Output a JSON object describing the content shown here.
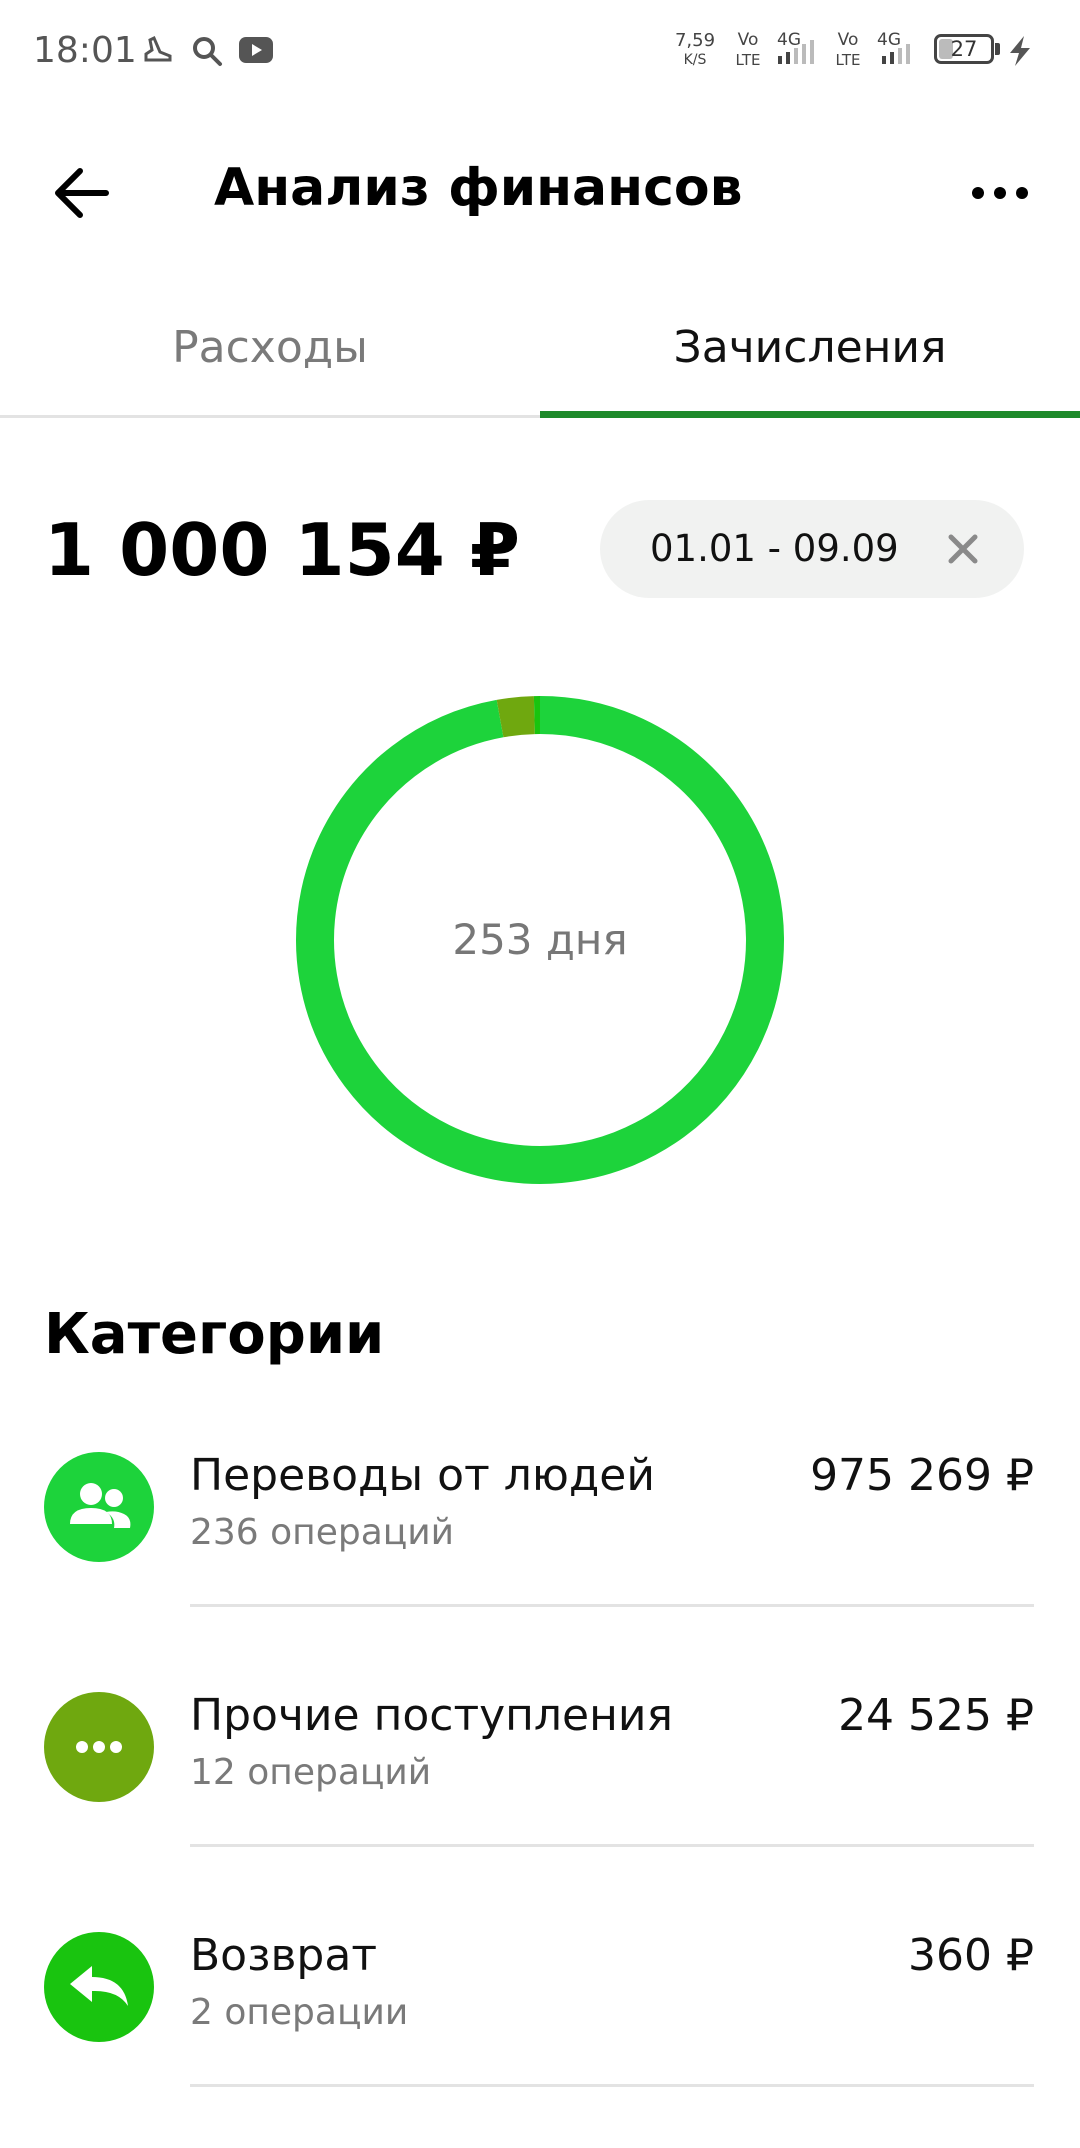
{
  "status_bar": {
    "time": "18:01",
    "net_speed_value": "7,59",
    "net_speed_unit": "K/S",
    "volte1_top": "Vo",
    "volte1_bottom": "LTE",
    "net1": "4G",
    "volte2_top": "Vo",
    "volte2_bottom": "LTE",
    "net2": "4G",
    "battery_level": "27",
    "icons": [
      "boot-icon",
      "search-icon",
      "youtube-icon",
      "signal-icon",
      "battery-icon",
      "charging-icon"
    ]
  },
  "header": {
    "title": "Анализ финансов",
    "back_icon": "arrow-left-icon",
    "more_icon": "more-horizontal-icon"
  },
  "tabs": [
    {
      "label": "Расходы",
      "active": false
    },
    {
      "label": "Зачисления",
      "active": true
    }
  ],
  "summary": {
    "total": "1 000 154 ₽",
    "period": "01.01 - 09.09"
  },
  "chart_data": {
    "type": "pie",
    "center_label": "253 дня",
    "categories": [
      "Переводы от людей",
      "Прочие поступления",
      "Возврат"
    ],
    "values": [
      975269,
      24525,
      360
    ],
    "colors": [
      "#1dd33b",
      "#6fa80f",
      "#19c40f"
    ]
  },
  "categories_section": {
    "title": "Категории",
    "items": [
      {
        "name": "Переводы от людей",
        "count": "236 операций",
        "amount": "975 269 ₽",
        "icon": "people-icon",
        "color": "#1dd33b"
      },
      {
        "name": "Прочие поступления",
        "count": "12 операций",
        "amount": "24 525 ₽",
        "icon": "dots-icon",
        "color": "#6fa80f"
      },
      {
        "name": "Возврат",
        "count": "2 операции",
        "amount": "360 ₽",
        "icon": "return-arrow-icon",
        "color": "#19c40f"
      }
    ]
  }
}
